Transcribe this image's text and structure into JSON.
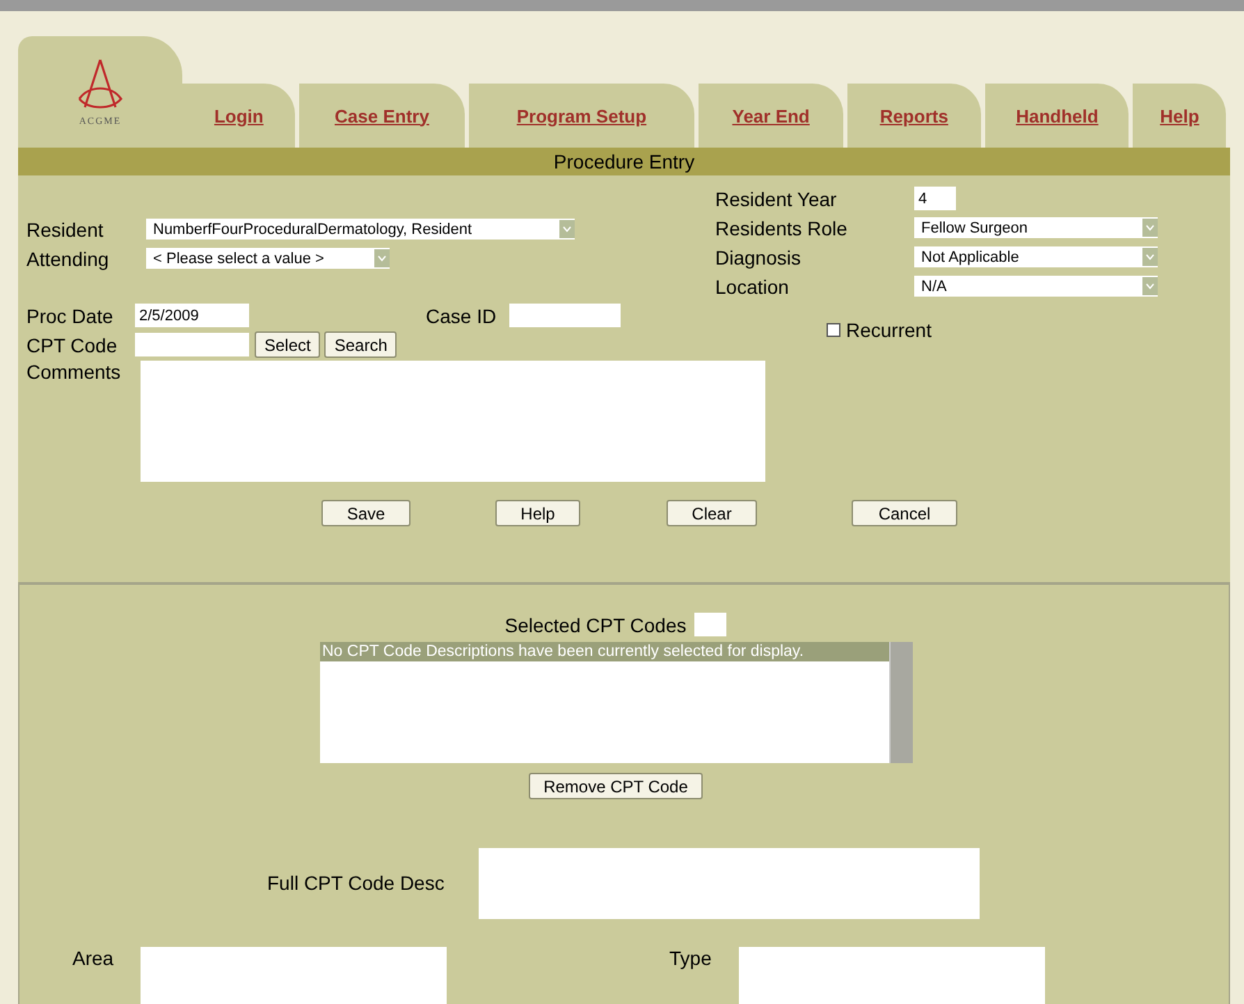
{
  "logo": {
    "text": "ACGME"
  },
  "nav_tabs": [
    {
      "label": "Login"
    },
    {
      "label": "Case Entry"
    },
    {
      "label": "Program Setup"
    },
    {
      "label": "Year End"
    },
    {
      "label": "Reports"
    },
    {
      "label": "Handheld"
    },
    {
      "label": "Help"
    }
  ],
  "title": "Procedure Entry",
  "left_fields": [
    {
      "label": "Resident",
      "value": "NumberfFourProceduralDermatology, Resident"
    },
    {
      "label": "Attending",
      "value": "< Please select a value >"
    }
  ],
  "right_fields": [
    {
      "label": "Resident Year",
      "kind": "input",
      "value": "4"
    },
    {
      "label": "Residents Role",
      "kind": "select",
      "value": "Fellow Surgeon"
    },
    {
      "label": "Diagnosis",
      "kind": "select",
      "value": "Not Applicable"
    },
    {
      "label": "Location",
      "kind": "select",
      "value": "N/A"
    }
  ],
  "proc_date": {
    "label": "Proc Date",
    "value": "2/5/2009"
  },
  "case_id": {
    "label": "Case ID"
  },
  "cpt_code": {
    "label": "CPT Code",
    "buttons": [
      "Select",
      "Search"
    ]
  },
  "recurrent": {
    "label": "Recurrent",
    "checked": false
  },
  "comments": {
    "label": "Comments"
  },
  "actions": [
    "Save",
    "Help",
    "Clear",
    "Cancel"
  ],
  "selected_codes": {
    "label": "Selected CPT Codes",
    "items": [
      {
        "text": "No CPT Code Descriptions have been currently selected for display.",
        "selected": true
      }
    ],
    "button": "Remove CPT Code"
  },
  "full_desc": {
    "label": "Full CPT Code Desc"
  },
  "area": {
    "label": "Area"
  },
  "type": {
    "label": "Type"
  }
}
